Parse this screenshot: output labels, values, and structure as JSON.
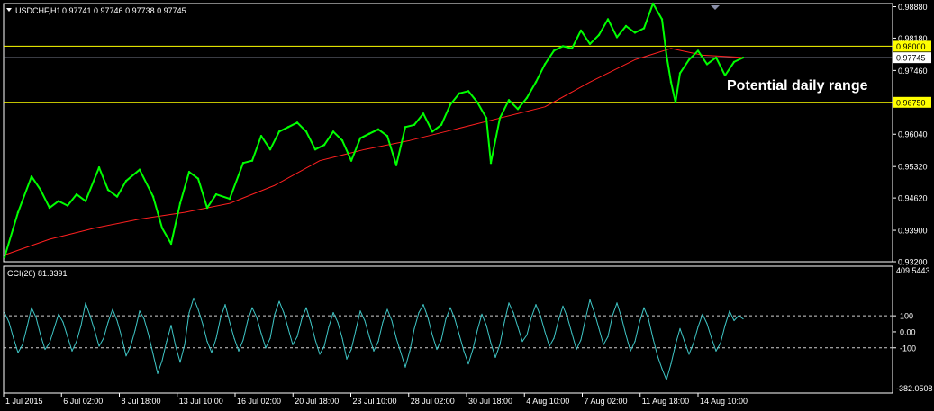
{
  "header": {
    "symbol": "USDCHF,H1",
    "ohlc": "0.97741 0.97746 0.97738 0.97745",
    "menu_icon": "triangle-down-icon"
  },
  "colors": {
    "background": "#000000",
    "price_line": "#00ff00",
    "moving_average": "#ff2020",
    "level_lines": "#ffff00",
    "current_price_line": "#9aa0b4",
    "cci_line": "#3fc7c7",
    "axis_text": "#ffffff",
    "grid_border": "#ffffff"
  },
  "chart_data": [
    {
      "type": "line",
      "title": "USDCHF,H1",
      "subtitle": "0.97741 0.97746 0.97738 0.97745",
      "annotation": "Potential daily range",
      "ylim": [
        0.932,
        0.9895
      ],
      "y_ticks": [
        "0.98880",
        "0.98180",
        "0.97460",
        "0.96040",
        "0.95320",
        "0.94620",
        "0.93900",
        "0.93200"
      ],
      "level_tags": [
        {
          "label": "0.98000",
          "value": 0.98,
          "style": "yellow"
        },
        {
          "label": "0.97745",
          "value": 0.97745,
          "style": "current"
        },
        {
          "label": "0.96750",
          "value": 0.9675,
          "style": "yellow"
        }
      ],
      "x_ticks": [
        "1 Jul 2015",
        "6 Jul 02:00",
        "8 Jul 18:00",
        "13 Jul 10:00",
        "16 Jul 02:00",
        "20 Jul 18:00",
        "23 Jul 10:00",
        "28 Jul 02:00",
        "30 Jul 18:00",
        "4 Aug 10:00",
        "7 Aug 02:00",
        "11 Aug 18:00",
        "14 Aug 10:00"
      ],
      "x_range": [
        0,
        157
      ],
      "series": [
        {
          "key": "price",
          "values": [
            [
              0,
              0.933
            ],
            [
              3,
              0.943
            ],
            [
              6,
              0.951
            ],
            [
              8,
              0.948
            ],
            [
              10,
              0.944
            ],
            [
              12,
              0.9455
            ],
            [
              14,
              0.9445
            ],
            [
              16,
              0.947
            ],
            [
              18,
              0.9455
            ],
            [
              21,
              0.953
            ],
            [
              23,
              0.948
            ],
            [
              25,
              0.9465
            ],
            [
              27,
              0.95
            ],
            [
              30,
              0.9525
            ],
            [
              33,
              0.9465
            ],
            [
              35,
              0.9395
            ],
            [
              37,
              0.936
            ],
            [
              39,
              0.945
            ],
            [
              41,
              0.952
            ],
            [
              43,
              0.9505
            ],
            [
              45,
              0.944
            ],
            [
              47,
              0.947
            ],
            [
              50,
              0.946
            ],
            [
              53,
              0.954
            ],
            [
              55,
              0.9545
            ],
            [
              57,
              0.96
            ],
            [
              59,
              0.957
            ],
            [
              61,
              0.961
            ],
            [
              63,
              0.962
            ],
            [
              65,
              0.963
            ],
            [
              67,
              0.961
            ],
            [
              69,
              0.957
            ],
            [
              71,
              0.958
            ],
            [
              73,
              0.961
            ],
            [
              75,
              0.959
            ],
            [
              77,
              0.9545
            ],
            [
              79,
              0.9595
            ],
            [
              81,
              0.9605
            ],
            [
              83,
              0.9615
            ],
            [
              85,
              0.96
            ],
            [
              87,
              0.9535
            ],
            [
              89,
              0.962
            ],
            [
              91,
              0.9625
            ],
            [
              93,
              0.965
            ],
            [
              95,
              0.961
            ],
            [
              97,
              0.9625
            ],
            [
              99,
              0.967
            ],
            [
              101,
              0.9695
            ],
            [
              103,
              0.97
            ],
            [
              105,
              0.9675
            ],
            [
              107,
              0.964
            ],
            [
              108,
              0.954
            ],
            [
              110,
              0.964
            ],
            [
              112,
              0.968
            ],
            [
              114,
              0.966
            ],
            [
              116,
              0.9685
            ],
            [
              118,
              0.972
            ],
            [
              120,
              0.976
            ],
            [
              122,
              0.979
            ],
            [
              124,
              0.98
            ],
            [
              126,
              0.9795
            ],
            [
              128,
              0.9835
            ],
            [
              130,
              0.9805
            ],
            [
              132,
              0.9825
            ],
            [
              134,
              0.986
            ],
            [
              136,
              0.982
            ],
            [
              138,
              0.9845
            ],
            [
              140,
              0.983
            ],
            [
              142,
              0.984
            ],
            [
              144,
              0.9895
            ],
            [
              146,
              0.986
            ],
            [
              147,
              0.978
            ],
            [
              148,
              0.972
            ],
            [
              149,
              0.9675
            ],
            [
              150,
              0.974
            ],
            [
              152,
              0.977
            ],
            [
              154,
              0.979
            ],
            [
              156,
              0.976
            ],
            [
              158,
              0.9775
            ],
            [
              160,
              0.9735
            ],
            [
              162,
              0.9765
            ],
            [
              164,
              0.97745
            ]
          ]
        },
        {
          "key": "ma",
          "values": [
            [
              0,
              0.9335
            ],
            [
              10,
              0.937
            ],
            [
              20,
              0.9395
            ],
            [
              30,
              0.9415
            ],
            [
              40,
              0.943
            ],
            [
              50,
              0.945
            ],
            [
              60,
              0.949
            ],
            [
              70,
              0.9545
            ],
            [
              80,
              0.957
            ],
            [
              90,
              0.959
            ],
            [
              100,
              0.9615
            ],
            [
              110,
              0.964
            ],
            [
              120,
              0.9665
            ],
            [
              130,
              0.972
            ],
            [
              140,
              0.977
            ],
            [
              148,
              0.9795
            ],
            [
              155,
              0.978
            ],
            [
              164,
              0.9775
            ]
          ]
        }
      ]
    },
    {
      "type": "line",
      "title": "CCI(20) 81.3391",
      "ylim": [
        -382.0508,
        409.5443
      ],
      "y_ticks": [
        "409.5443",
        "100",
        "0.00",
        "-100",
        "-382.0508"
      ],
      "reference_lines": [
        100,
        -100
      ],
      "series": [
        {
          "key": "cci",
          "values": [
            [
              0,
              120
            ],
            [
              1,
              60
            ],
            [
              2,
              -40
            ],
            [
              3,
              -130
            ],
            [
              4,
              -80
            ],
            [
              5,
              30
            ],
            [
              6,
              150
            ],
            [
              7,
              90
            ],
            [
              8,
              -20
            ],
            [
              9,
              -110
            ],
            [
              10,
              -70
            ],
            [
              11,
              20
            ],
            [
              12,
              110
            ],
            [
              13,
              60
            ],
            [
              14,
              -30
            ],
            [
              15,
              -120
            ],
            [
              16,
              -60
            ],
            [
              17,
              40
            ],
            [
              18,
              180
            ],
            [
              19,
              100
            ],
            [
              20,
              10
            ],
            [
              21,
              -90
            ],
            [
              22,
              -40
            ],
            [
              23,
              60
            ],
            [
              24,
              140
            ],
            [
              25,
              70
            ],
            [
              26,
              -30
            ],
            [
              27,
              -150
            ],
            [
              28,
              -90
            ],
            [
              29,
              10
            ],
            [
              30,
              130
            ],
            [
              31,
              80
            ],
            [
              32,
              -20
            ],
            [
              33,
              -140
            ],
            [
              34,
              -260
            ],
            [
              35,
              -180
            ],
            [
              36,
              -60
            ],
            [
              37,
              40
            ],
            [
              38,
              -90
            ],
            [
              39,
              -190
            ],
            [
              40,
              -80
            ],
            [
              41,
              120
            ],
            [
              42,
              210
            ],
            [
              43,
              140
            ],
            [
              44,
              50
            ],
            [
              45,
              -60
            ],
            [
              46,
              -130
            ],
            [
              47,
              -40
            ],
            [
              48,
              90
            ],
            [
              49,
              170
            ],
            [
              50,
              60
            ],
            [
              51,
              -40
            ],
            [
              52,
              -120
            ],
            [
              53,
              -50
            ],
            [
              54,
              70
            ],
            [
              55,
              150
            ],
            [
              56,
              90
            ],
            [
              57,
              -10
            ],
            [
              58,
              -100
            ],
            [
              59,
              -40
            ],
            [
              60,
              110
            ],
            [
              61,
              190
            ],
            [
              62,
              120
            ],
            [
              63,
              20
            ],
            [
              64,
              -80
            ],
            [
              65,
              -30
            ],
            [
              66,
              80
            ],
            [
              67,
              150
            ],
            [
              68,
              60
            ],
            [
              69,
              -50
            ],
            [
              70,
              -140
            ],
            [
              71,
              -90
            ],
            [
              72,
              30
            ],
            [
              73,
              120
            ],
            [
              74,
              60
            ],
            [
              75,
              -40
            ],
            [
              76,
              -170
            ],
            [
              77,
              -110
            ],
            [
              78,
              10
            ],
            [
              79,
              130
            ],
            [
              80,
              70
            ],
            [
              81,
              -30
            ],
            [
              82,
              -120
            ],
            [
              83,
              -60
            ],
            [
              84,
              60
            ],
            [
              85,
              140
            ],
            [
              86,
              70
            ],
            [
              87,
              -40
            ],
            [
              88,
              -130
            ],
            [
              89,
              -220
            ],
            [
              90,
              -120
            ],
            [
              91,
              20
            ],
            [
              92,
              120
            ],
            [
              93,
              170
            ],
            [
              94,
              90
            ],
            [
              95,
              -20
            ],
            [
              96,
              -110
            ],
            [
              97,
              -50
            ],
            [
              98,
              80
            ],
            [
              99,
              150
            ],
            [
              100,
              80
            ],
            [
              101,
              -20
            ],
            [
              102,
              -120
            ],
            [
              103,
              -200
            ],
            [
              104,
              -110
            ],
            [
              105,
              10
            ],
            [
              106,
              110
            ],
            [
              107,
              40
            ],
            [
              108,
              -70
            ],
            [
              109,
              -160
            ],
            [
              110,
              -80
            ],
            [
              111,
              60
            ],
            [
              112,
              180
            ],
            [
              113,
              120
            ],
            [
              114,
              30
            ],
            [
              115,
              -60
            ],
            [
              116,
              -20
            ],
            [
              117,
              90
            ],
            [
              118,
              170
            ],
            [
              119,
              100
            ],
            [
              120,
              0
            ],
            [
              121,
              -90
            ],
            [
              122,
              -40
            ],
            [
              123,
              70
            ],
            [
              124,
              160
            ],
            [
              125,
              90
            ],
            [
              126,
              -10
            ],
            [
              127,
              -110
            ],
            [
              128,
              -50
            ],
            [
              129,
              80
            ],
            [
              130,
              200
            ],
            [
              131,
              120
            ],
            [
              132,
              20
            ],
            [
              133,
              -80
            ],
            [
              134,
              -30
            ],
            [
              135,
              100
            ],
            [
              136,
              180
            ],
            [
              137,
              90
            ],
            [
              138,
              -20
            ],
            [
              139,
              -120
            ],
            [
              140,
              -60
            ],
            [
              141,
              60
            ],
            [
              142,
              150
            ],
            [
              143,
              80
            ],
            [
              144,
              -40
            ],
            [
              145,
              -150
            ],
            [
              146,
              -230
            ],
            [
              147,
              -300
            ],
            [
              148,
              -200
            ],
            [
              149,
              -80
            ],
            [
              150,
              20
            ],
            [
              151,
              -60
            ],
            [
              152,
              -140
            ],
            [
              153,
              -70
            ],
            [
              154,
              30
            ],
            [
              155,
              110
            ],
            [
              156,
              50
            ],
            [
              157,
              -40
            ],
            [
              158,
              -120
            ],
            [
              159,
              -70
            ],
            [
              160,
              40
            ],
            [
              161,
              130
            ],
            [
              162,
              70
            ],
            [
              163,
              100
            ],
            [
              164,
              81
            ]
          ]
        }
      ]
    }
  ]
}
